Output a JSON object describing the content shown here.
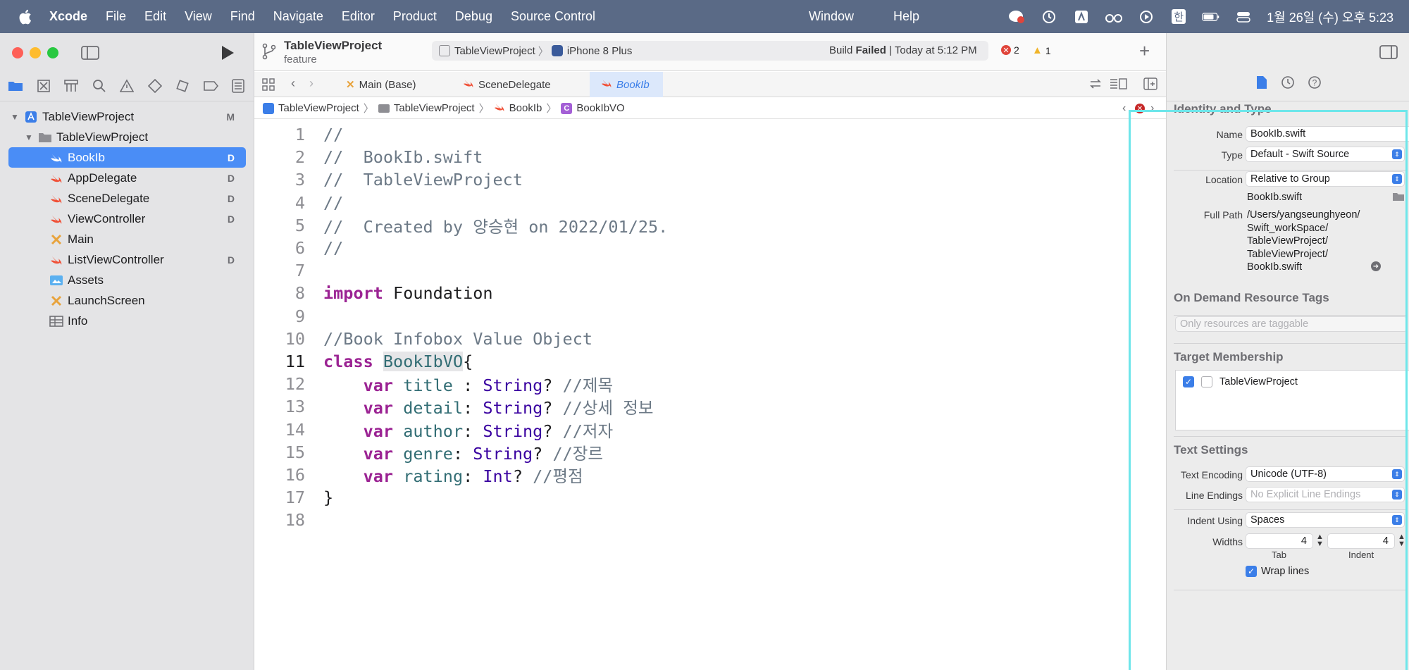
{
  "menubar": {
    "app": "Xcode",
    "items": [
      "File",
      "Edit",
      "View",
      "Find",
      "Navigate",
      "Editor",
      "Product",
      "Debug",
      "Source Control"
    ],
    "center_items": [
      "Window",
      "Help"
    ],
    "clock": "1월 26일 (수) 오후 5:23",
    "input_method": "한"
  },
  "navigator": {
    "tree": [
      {
        "label": "TableViewProject",
        "badge": "M",
        "icon": "xcode-project-icon",
        "level": 0,
        "chevron": "down"
      },
      {
        "label": "TableViewProject",
        "badge": "",
        "icon": "folder-icon",
        "level": 1,
        "chevron": "down"
      },
      {
        "label": "BookIb",
        "badge": "D",
        "icon": "swift-file-icon",
        "level": 2,
        "selected": true
      },
      {
        "label": "AppDelegate",
        "badge": "D",
        "icon": "swift-file-icon",
        "level": 2
      },
      {
        "label": "SceneDelegate",
        "badge": "D",
        "icon": "swift-file-icon",
        "level": 2
      },
      {
        "label": "ViewController",
        "badge": "D",
        "icon": "swift-file-icon",
        "level": 2
      },
      {
        "label": "Main",
        "badge": "",
        "icon": "storyboard-icon",
        "level": 2
      },
      {
        "label": "ListViewController",
        "badge": "D",
        "icon": "swift-file-icon",
        "level": 2
      },
      {
        "label": "Assets",
        "badge": "",
        "icon": "assets-icon",
        "level": 2
      },
      {
        "label": "LaunchScreen",
        "badge": "",
        "icon": "storyboard-icon",
        "level": 2
      },
      {
        "label": "Info",
        "badge": "",
        "icon": "plist-icon",
        "level": 2
      }
    ]
  },
  "toolbar": {
    "project_title": "TableViewProject",
    "branch": "feature",
    "scheme": "TableViewProject",
    "device": "iPhone 8 Plus",
    "build_prefix": "Build ",
    "build_status": "Failed",
    "build_suffix": " | Today at 5:12 PM",
    "errors": "2",
    "warnings": "1"
  },
  "tabs": [
    {
      "label": "Main (Base)",
      "icon": "storyboard-icon"
    },
    {
      "label": "SceneDelegate",
      "icon": "swift-file-icon"
    },
    {
      "label": "BookIb",
      "icon": "swift-file-icon",
      "active": true
    }
  ],
  "breadcrumb": [
    "TableViewProject",
    "TableViewProject",
    "BookIb",
    "BookIbVO"
  ],
  "code": {
    "current_line": 11,
    "lines": [
      "//",
      "//  BookIb.swift",
      "//  TableViewProject",
      "//",
      "//  Created by 양승현 on 2022/01/25.",
      "//",
      "",
      "import Foundation",
      "",
      "//Book Infobox Value Object",
      "class BookIbVO{",
      "    var title : String? //제목",
      "    var detail: String? //상세 정보",
      "    var author: String? //저자",
      "    var genre: String? //장르",
      "    var rating: Int? //평점",
      "}",
      ""
    ]
  },
  "inspector": {
    "identity_header": "Identity and Type",
    "name_label": "Name",
    "name_value": "BookIb.swift",
    "type_label": "Type",
    "type_value": "Default - Swift Source",
    "location_label": "Location",
    "location_value": "Relative to Group",
    "location_file": "BookIb.swift",
    "full_path_label": "Full Path",
    "full_path": [
      "/Users/yangseunghyeon/",
      "Swift_workSpace/",
      "TableViewProject/",
      "TableViewProject/",
      "BookIb.swift"
    ],
    "odr_header": "On Demand Resource Tags",
    "odr_placeholder": "Only resources are taggable",
    "target_header": "Target Membership",
    "target_name": "TableViewProject",
    "text_header": "Text Settings",
    "encoding_label": "Text Encoding",
    "encoding_value": "Unicode (UTF-8)",
    "line_endings_label": "Line Endings",
    "line_endings_value": "No Explicit Line Endings",
    "indent_using_label": "Indent Using",
    "indent_using_value": "Spaces",
    "widths_label": "Widths",
    "tab_width": "4",
    "indent_width": "4",
    "tab_caption": "Tab",
    "indent_caption": "Indent",
    "wrap_label": "Wrap lines"
  }
}
